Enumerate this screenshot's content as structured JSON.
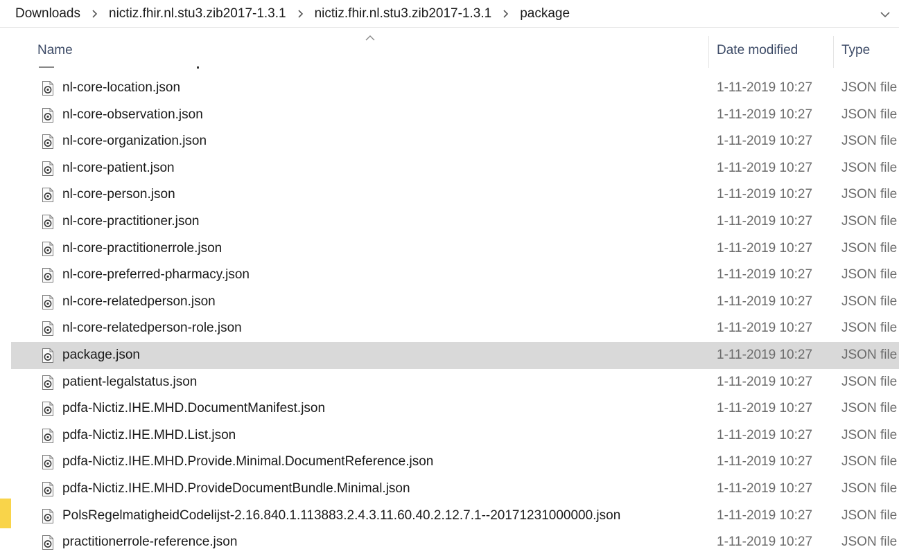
{
  "breadcrumb": {
    "items": [
      {
        "label": "Downloads"
      },
      {
        "label": "nictiz.fhir.nl.stu3.zib2017-1.3.1"
      },
      {
        "label": "nictiz.fhir.nl.stu3.zib2017-1.3.1"
      },
      {
        "label": "package"
      }
    ],
    "separator_icon": "chevron-right-icon",
    "dropdown_icon": "chevron-down-icon"
  },
  "columns": {
    "name": "Name",
    "date_modified": "Date modified",
    "type": "Type",
    "sort_icon": "sort-ascending-icon"
  },
  "files": [
    {
      "name": "nl-core-location.json",
      "date": "1-11-2019 10:27",
      "type": "JSON file",
      "selected": false
    },
    {
      "name": "nl-core-observation.json",
      "date": "1-11-2019 10:27",
      "type": "JSON file",
      "selected": false
    },
    {
      "name": "nl-core-organization.json",
      "date": "1-11-2019 10:27",
      "type": "JSON file",
      "selected": false
    },
    {
      "name": "nl-core-patient.json",
      "date": "1-11-2019 10:27",
      "type": "JSON file",
      "selected": false
    },
    {
      "name": "nl-core-person.json",
      "date": "1-11-2019 10:27",
      "type": "JSON file",
      "selected": false
    },
    {
      "name": "nl-core-practitioner.json",
      "date": "1-11-2019 10:27",
      "type": "JSON file",
      "selected": false
    },
    {
      "name": "nl-core-practitionerrole.json",
      "date": "1-11-2019 10:27",
      "type": "JSON file",
      "selected": false
    },
    {
      "name": "nl-core-preferred-pharmacy.json",
      "date": "1-11-2019 10:27",
      "type": "JSON file",
      "selected": false
    },
    {
      "name": "nl-core-relatedperson.json",
      "date": "1-11-2019 10:27",
      "type": "JSON file",
      "selected": false
    },
    {
      "name": "nl-core-relatedperson-role.json",
      "date": "1-11-2019 10:27",
      "type": "JSON file",
      "selected": false
    },
    {
      "name": "package.json",
      "date": "1-11-2019 10:27",
      "type": "JSON file",
      "selected": true
    },
    {
      "name": "patient-legalstatus.json",
      "date": "1-11-2019 10:27",
      "type": "JSON file",
      "selected": false
    },
    {
      "name": "pdfa-Nictiz.IHE.MHD.DocumentManifest.json",
      "date": "1-11-2019 10:27",
      "type": "JSON file",
      "selected": false
    },
    {
      "name": "pdfa-Nictiz.IHE.MHD.List.json",
      "date": "1-11-2019 10:27",
      "type": "JSON file",
      "selected": false
    },
    {
      "name": "pdfa-Nictiz.IHE.MHD.Provide.Minimal.DocumentReference.json",
      "date": "1-11-2019 10:27",
      "type": "JSON file",
      "selected": false
    },
    {
      "name": "pdfa-Nictiz.IHE.MHD.ProvideDocumentBundle.Minimal.json",
      "date": "1-11-2019 10:27",
      "type": "JSON file",
      "selected": false
    },
    {
      "name": "PolsRegelmatigheidCodelijst-2.16.840.1.113883.2.4.3.11.60.40.2.12.7.1--20171231000000.json",
      "date": "1-11-2019 10:27",
      "type": "JSON file",
      "selected": false
    },
    {
      "name": "practitionerrole-reference.json",
      "date": "1-11-2019 10:27",
      "type": "JSON file",
      "selected": false
    }
  ],
  "file_icon": "json-file-icon",
  "colors": {
    "selected_row": "#d9d9d9",
    "header_text": "#3c4a66",
    "secondary_text": "#6b6b6b",
    "accent_yellow": "#f9d44a"
  }
}
